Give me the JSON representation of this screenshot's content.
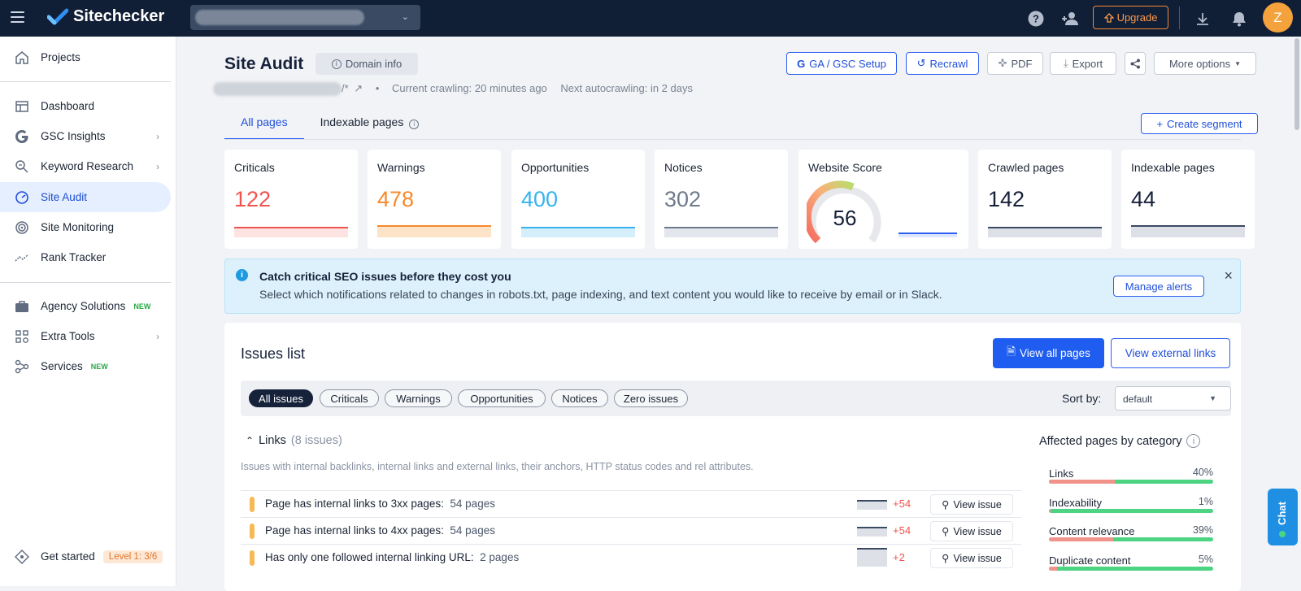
{
  "app": {
    "name": "Sitechecker",
    "avatar_initial": "Z",
    "upgrade_label": "Upgrade"
  },
  "sidebar": {
    "items": [
      {
        "label": "Projects",
        "icon": "home-icon"
      },
      {
        "label": "Dashboard",
        "icon": "dashboard-icon"
      },
      {
        "label": "GSC Insights",
        "icon": "google-icon"
      },
      {
        "label": "Keyword Research",
        "icon": "keyword-search-icon"
      },
      {
        "label": "Site Audit",
        "icon": "gauge-icon"
      },
      {
        "label": "Site Monitoring",
        "icon": "monitoring-icon"
      },
      {
        "label": "Rank Tracker",
        "icon": "trend-icon"
      },
      {
        "label": "Agency Solutions",
        "icon": "briefcase-icon",
        "badge": "NEW"
      },
      {
        "label": "Extra Tools",
        "icon": "tools-grid-icon"
      },
      {
        "label": "Services",
        "icon": "services-icon",
        "badge": "NEW"
      },
      {
        "label": "Get started",
        "icon": "diamond-icon",
        "level": "Level 1: 3/6"
      }
    ]
  },
  "header": {
    "title": "Site Audit",
    "domain_info": "Domain info",
    "url_suffix": "/*",
    "current_crawling": "Current crawling: 20 minutes ago",
    "next_autocrawling": "Next autocrawling: in 2 days",
    "buttons": {
      "ga_gsc": "GA / GSC Setup",
      "recrawl": "Recrawl",
      "pdf": "PDF",
      "export": "Export",
      "more": "More options"
    }
  },
  "tabs": [
    {
      "label": "All pages"
    },
    {
      "label": "Indexable pages"
    }
  ],
  "create_segment": "Create segment",
  "cards": [
    {
      "label": "Criticals",
      "value": "122",
      "color": "#f0544f"
    },
    {
      "label": "Warnings",
      "value": "478",
      "color": "#f7892c"
    },
    {
      "label": "Opportunities",
      "value": "400",
      "color": "#36b3ee"
    },
    {
      "label": "Notices",
      "value": "302",
      "color": "#6f7a8c"
    },
    {
      "label": "Website Score",
      "value": "56"
    },
    {
      "label": "Crawled pages",
      "value": "142"
    },
    {
      "label": "Indexable pages",
      "value": "44"
    }
  ],
  "banner": {
    "title": "Catch critical SEO issues before they cost you",
    "text": "Select which notifications related to changes in robots.txt, page indexing, and text content you would like to receive by email or in Slack.",
    "button": "Manage alerts"
  },
  "issues": {
    "title": "Issues list",
    "view_all": "View all pages",
    "view_external": "View external links",
    "filters": [
      "All issues",
      "Criticals",
      "Warnings",
      "Opportunities",
      "Notices",
      "Zero issues"
    ],
    "sort_label": "Sort by:",
    "sort_value": "default",
    "section_title": "Links",
    "section_count": "(8 issues)",
    "section_desc": "Issues with internal backlinks, internal links and external links, their anchors, HTTP status codes and rel attributes.",
    "view_issue_label": "View issue",
    "rows": [
      {
        "text": "Page has internal links to 3xx pages:",
        "pages": "54 pages",
        "delta": "+54"
      },
      {
        "text": "Page has internal links to 4xx pages:",
        "pages": "54 pages",
        "delta": "+54"
      },
      {
        "text": "Has only one followed internal linking URL:",
        "pages": "2 pages",
        "delta": "+2"
      }
    ]
  },
  "affected": {
    "title": "Affected pages by category",
    "rows": [
      {
        "name": "Links",
        "percent": "40%",
        "red_fraction": 0.4
      },
      {
        "name": "Indexability",
        "percent": "1%",
        "red_fraction": 0.01
      },
      {
        "name": "Content relevance",
        "percent": "39%",
        "red_fraction": 0.39
      },
      {
        "name": "Duplicate content",
        "percent": "5%",
        "red_fraction": 0.05
      }
    ]
  },
  "chat_label": "Chat"
}
